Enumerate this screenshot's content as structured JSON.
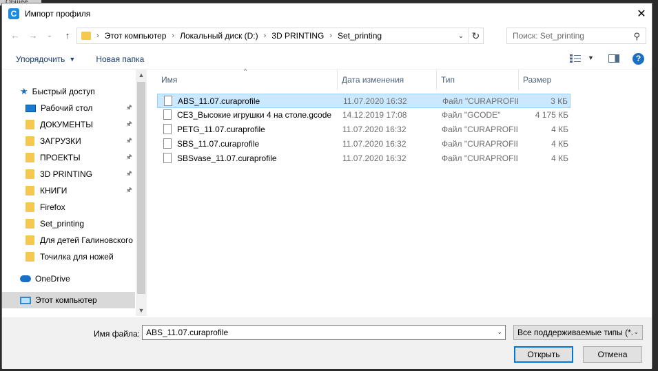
{
  "background": {
    "top_left_text": "Общее"
  },
  "window": {
    "title": "Импорт профиля",
    "app_icon_letter": "C",
    "close_glyph": "✕"
  },
  "nav": {
    "back_glyph": "←",
    "forward_glyph": "→",
    "recent_glyph": "⌄",
    "up_glyph": "↑",
    "breadcrumb": [
      "Этот компьютер",
      "Локальный диск (D:)",
      "3D PRINTING",
      "Set_printing"
    ],
    "separator": "›",
    "dropdown_glyph": "⌄",
    "refresh_glyph": "↻",
    "search_placeholder": "Поиск: Set_printing",
    "search_glyph": "⚲"
  },
  "toolbar": {
    "organize_label": "Упорядочить",
    "organize_caret": "▼",
    "new_folder_label": "Новая папка",
    "view_caret": "▼",
    "help_glyph": "?"
  },
  "sidebar": {
    "quick_access": "Быстрый доступ",
    "items": [
      {
        "label": "Рабочий стол",
        "pinned": true,
        "icon": "desktop"
      },
      {
        "label": "ДОКУМЕНТЫ",
        "pinned": true,
        "icon": "folder"
      },
      {
        "label": "ЗАГРУЗКИ",
        "pinned": true,
        "icon": "folder"
      },
      {
        "label": "ПРОЕКТЫ",
        "pinned": true,
        "icon": "folder"
      },
      {
        "label": "3D PRINTING",
        "pinned": true,
        "icon": "folder"
      },
      {
        "label": "КНИГИ",
        "pinned": true,
        "icon": "folder"
      },
      {
        "label": "Firefox",
        "pinned": false,
        "icon": "folder"
      },
      {
        "label": "Set_printing",
        "pinned": false,
        "icon": "folder"
      },
      {
        "label": "Для детей Галиновского",
        "pinned": false,
        "icon": "folder"
      },
      {
        "label": "Точилка для ножей",
        "pinned": false,
        "icon": "folder"
      }
    ],
    "onedrive": "OneDrive",
    "this_pc": "Этот компьютер",
    "pin_glyph": "📌",
    "scroll_up": "▲",
    "scroll_down": "▼"
  },
  "list": {
    "columns": {
      "name": "Имя",
      "date": "Дата изменения",
      "type": "Тип",
      "size": "Размер"
    },
    "sort_glyph": "^",
    "files": [
      {
        "name": "ABS_11.07.curaprofile",
        "date": "11.07.2020 16:32",
        "type": "Файл \"CURAPROFILE\"",
        "size": "3 КБ",
        "selected": true
      },
      {
        "name": "CE3_Высокие игрушки 4 на столе.gcode",
        "date": "14.12.2019 17:08",
        "type": "Файл \"GCODE\"",
        "size": "4 175 КБ",
        "selected": false
      },
      {
        "name": "PETG_11.07.curaprofile",
        "date": "11.07.2020 16:32",
        "type": "Файл \"CURAPROFILE\"",
        "size": "4 КБ",
        "selected": false
      },
      {
        "name": "SBS_11.07.curaprofile",
        "date": "11.07.2020 16:32",
        "type": "Файл \"CURAPROFILE\"",
        "size": "4 КБ",
        "selected": false
      },
      {
        "name": "SBSvase_11.07.curaprofile",
        "date": "11.07.2020 16:32",
        "type": "Файл \"CURAPROFILE\"",
        "size": "4 КБ",
        "selected": false
      }
    ]
  },
  "bottom": {
    "filename_label": "Имя файла:",
    "filename_value": "ABS_11.07.curaprofile",
    "filename_dropdown_glyph": "⌄",
    "filetype_value": "Все поддерживаемые типы (*.",
    "filetype_dropdown_glyph": "⌄",
    "open_label": "Открыть",
    "cancel_label": "Отмена"
  }
}
